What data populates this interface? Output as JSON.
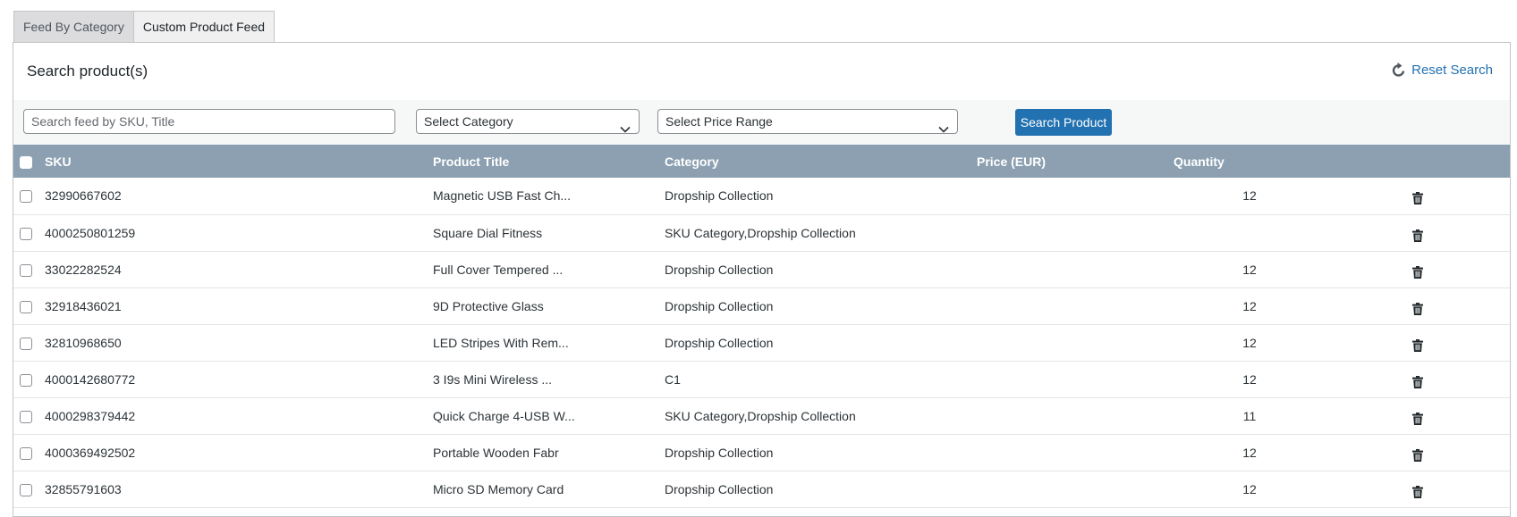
{
  "tabs": [
    {
      "label": "Feed By Category",
      "active": false
    },
    {
      "label": "Custom Product Feed",
      "active": true
    }
  ],
  "panel": {
    "title": "Search product(s)",
    "reset_label": "Reset Search",
    "reset_icon": "refresh-icon"
  },
  "filters": {
    "search_placeholder": "Search feed by SKU, Title",
    "search_value": "",
    "category_selected": "Select Category",
    "price_selected": "Select Price Range",
    "search_button": "Search Product"
  },
  "table": {
    "columns": [
      "SKU",
      "Product Title",
      "Category",
      "Price (EUR)",
      "Quantity"
    ],
    "rows": [
      {
        "sku": "32990667602",
        "title": "Magnetic USB Fast Ch...",
        "category": "Dropship Collection",
        "price": "",
        "quantity": "12"
      },
      {
        "sku": "4000250801259",
        "title": "Square Dial Fitness",
        "category": "SKU Category,Dropship Collection",
        "price": "",
        "quantity": ""
      },
      {
        "sku": "33022282524",
        "title": "Full Cover Tempered ...",
        "category": "Dropship Collection",
        "price": "",
        "quantity": "12"
      },
      {
        "sku": "32918436021",
        "title": "9D Protective Glass",
        "category": "Dropship Collection",
        "price": "",
        "quantity": "12"
      },
      {
        "sku": "32810968650",
        "title": "LED Stripes With Rem...",
        "category": "Dropship Collection",
        "price": "",
        "quantity": "12"
      },
      {
        "sku": "4000142680772",
        "title": "3 I9s Mini Wireless ...",
        "category": "C1",
        "price": "",
        "quantity": "12"
      },
      {
        "sku": "4000298379442",
        "title": "Quick Charge 4-USB W...",
        "category": "SKU Category,Dropship Collection",
        "price": "",
        "quantity": "11"
      },
      {
        "sku": "4000369492502",
        "title": "Portable Wooden Fabr",
        "category": "Dropship Collection",
        "price": "",
        "quantity": "12"
      },
      {
        "sku": "32855791603",
        "title": "Micro SD Memory Card",
        "category": "Dropship Collection",
        "price": "",
        "quantity": "12"
      }
    ],
    "row_action_icon": "trash-icon"
  },
  "colors": {
    "accent": "#2271b1",
    "header_bg": "#8ca0b1",
    "filter_bg": "#f6f7f7"
  }
}
